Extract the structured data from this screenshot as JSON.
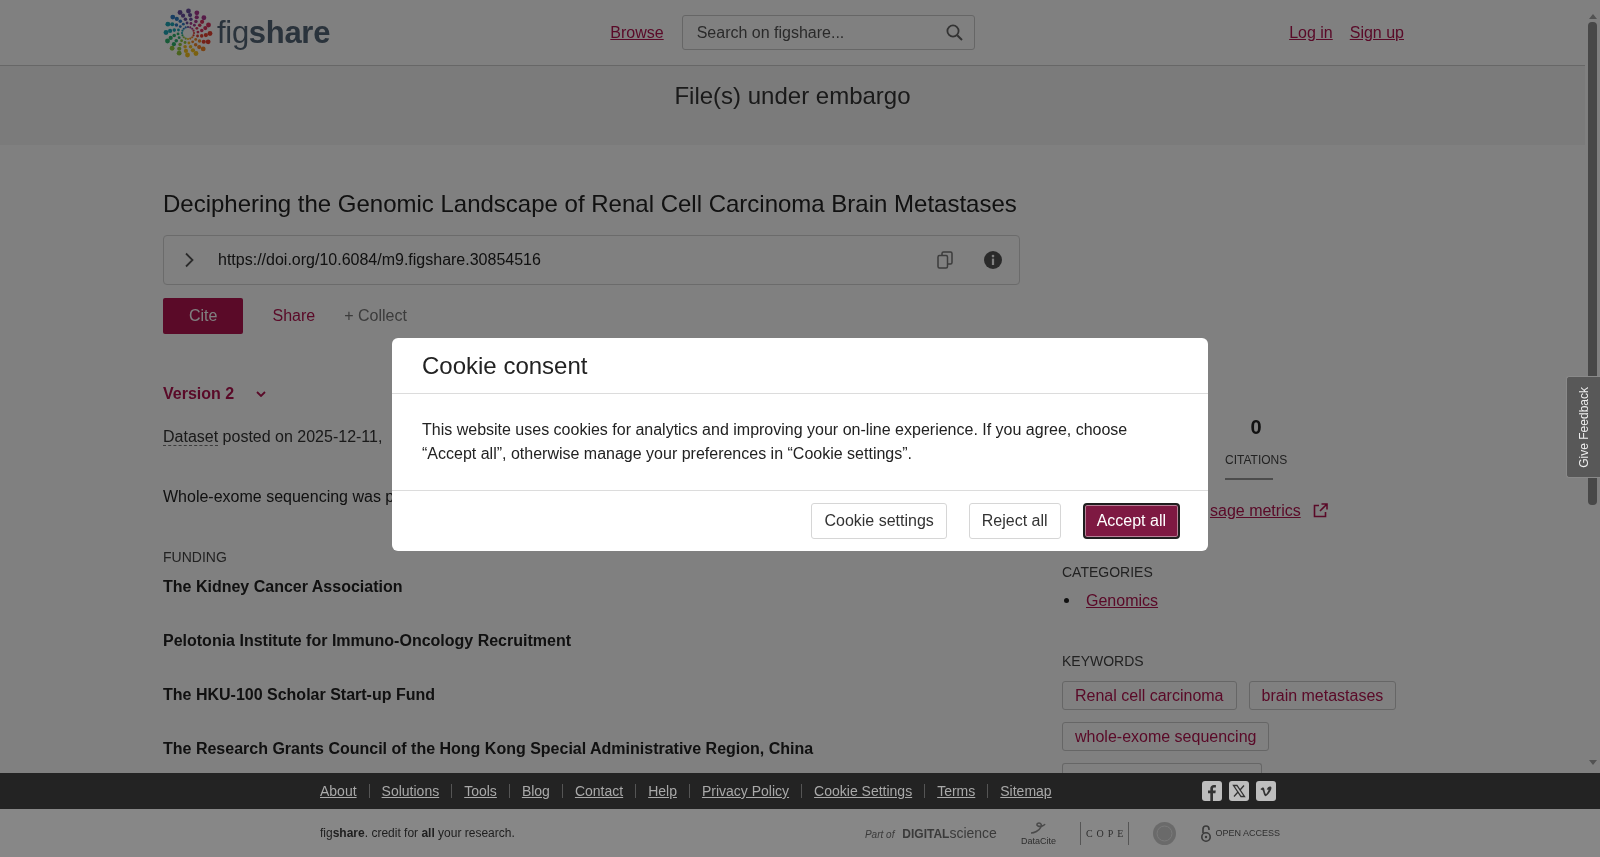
{
  "header": {
    "logo": "fig**share**",
    "browse_link": "Browse",
    "search": {
      "placeholder": "Search on figshare..."
    },
    "account_links": [
      "Log in",
      "Sign up"
    ]
  },
  "banner": {
    "text": "File(s) under embargo"
  },
  "item": {
    "title": "Deciphering the Genomic Landscape of Renal Cell Carcinoma Brain Metastases",
    "doi": "https://doi.org/10.6084/m9.figshare.30854516",
    "actions": [
      {
        "label": "Cite",
        "kind": "primary"
      },
      {
        "label": "Share",
        "kind": "link"
      },
      {
        "label": "+ Collect",
        "kind": "muted"
      }
    ],
    "version": "Version 2",
    "item_type": "Dataset",
    "posted": "posted on 2025-12-11,",
    "description": "Whole-exome sequencing was p",
    "funding": {
      "heading": "FUNDING",
      "items": [
        "The Kidney Cancer Association",
        "Pelotonia Institute for Immuno-Oncology Recruitment",
        "The HKU-100 Scholar Start-up Fund",
        "The Research Grants Council of the Hong Kong Special Administrative Region, China"
      ]
    }
  },
  "sidebar": {
    "stats": [
      {
        "value": "0",
        "label": "CITATIONS",
        "selected": true
      }
    ],
    "usage_link": "sage metrics",
    "categories": {
      "heading": "CATEGORIES",
      "items": [
        "Genomics"
      ]
    },
    "keywords": {
      "heading": "KEYWORDS",
      "items": [
        "Renal cell carcinoma",
        "brain metastases",
        "whole-exome sequencing"
      ],
      "clipped_tag": true
    }
  },
  "feedback_tab": "Give Feedback",
  "footer": {
    "links": [
      "About",
      "Solutions",
      "Tools",
      "Blog",
      "Contact",
      "Help",
      "Privacy Policy",
      "Cookie Settings",
      "Terms",
      "Sitemap"
    ],
    "social": [
      {
        "kind": "facebook"
      },
      {
        "kind": "x"
      },
      {
        "kind": "vimeo"
      }
    ],
    "tagline": "fig**share**. credit for **all** your research.",
    "partners": [
      {
        "kind": "digital-science",
        "name": "*Part of* **DIGITAL**science"
      },
      {
        "kind": "datacite",
        "name": "DataCite"
      },
      {
        "kind": "cope",
        "name": "COPE"
      },
      {
        "kind": "seal"
      },
      {
        "kind": "open-access",
        "name": "OPEN ACCESS"
      }
    ]
  },
  "cookie_modal": {
    "title": "Cookie consent",
    "body": "This website uses cookies for analytics and improving your on-line experience. If you agree, choose “Accept all”, otherwise manage your preferences in “Cookie settings”.",
    "buttons": [
      {
        "label": "Cookie settings",
        "kind": "secondary",
        "focused": false
      },
      {
        "label": "Reject all",
        "kind": "secondary",
        "focused": false
      },
      {
        "label": "Accept all",
        "kind": "primary",
        "focused": true
      }
    ]
  }
}
